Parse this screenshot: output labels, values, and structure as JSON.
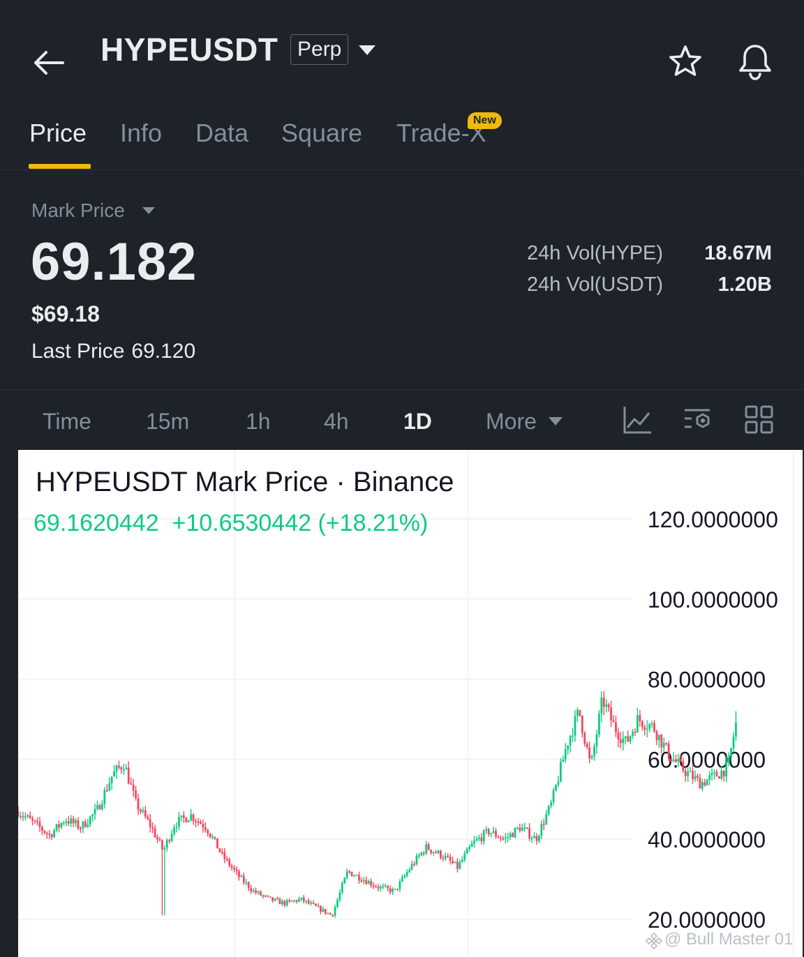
{
  "header": {
    "symbol": "HYPEUSDT",
    "contract_type": "Perp",
    "icons": [
      "back-arrow-icon",
      "caret-down-icon",
      "star-icon",
      "bell-icon"
    ]
  },
  "tabs": [
    {
      "label": "Price",
      "active": true
    },
    {
      "label": "Info"
    },
    {
      "label": "Data"
    },
    {
      "label": "Square"
    },
    {
      "label": "Trade-X",
      "badge": "New"
    }
  ],
  "price": {
    "mark_label": "Mark Price",
    "mark_price": "69.182",
    "usd_value": "$69.18",
    "last_label": "Last Price",
    "last_value": "69.120",
    "stats": [
      {
        "label": "24h Vol(HYPE)",
        "value": "18.67M"
      },
      {
        "label": "24h Vol(USDT)",
        "value": "1.20B"
      }
    ]
  },
  "intervals": [
    "Time",
    "15m",
    "1h",
    "4h",
    "1D",
    "More"
  ],
  "active_interval": "1D",
  "toolbar_icons": [
    "indicator-chart-icon",
    "settings-sliders-icon",
    "grid-layout-icon"
  ],
  "chart": {
    "title": "HYPEUSDT Mark Price · Binance",
    "last_value": "69.1620442",
    "change": "+10.6530442",
    "change_pct": "(+18.21%)",
    "y_ticks": [
      "120.0000000",
      "100.0000000",
      "80.0000000",
      "60.0000000",
      "40.0000000",
      "20.0000000"
    ]
  },
  "chart_data": {
    "type": "candlestick",
    "title": "HYPEUSDT Mark Price · Binance",
    "ylim": [
      20,
      120
    ],
    "y_ticks": [
      120,
      100,
      80,
      60,
      40,
      20
    ],
    "grid": true,
    "up_color": "#0ecb81",
    "down_color": "#f6465d",
    "close_path": [
      [
        0,
        47
      ],
      [
        0.02,
        44
      ],
      [
        0.04,
        41
      ],
      [
        0.06,
        45
      ],
      [
        0.08,
        43
      ],
      [
        0.1,
        47
      ],
      [
        0.12,
        56
      ],
      [
        0.135,
        59
      ],
      [
        0.15,
        49
      ],
      [
        0.17,
        43
      ],
      [
        0.185,
        37
      ],
      [
        0.2,
        44
      ],
      [
        0.22,
        46
      ],
      [
        0.24,
        43
      ],
      [
        0.26,
        36
      ],
      [
        0.28,
        31
      ],
      [
        0.3,
        27
      ],
      [
        0.32,
        25
      ],
      [
        0.34,
        24
      ],
      [
        0.36,
        25
      ],
      [
        0.38,
        23
      ],
      [
        0.4,
        21
      ],
      [
        0.42,
        32
      ],
      [
        0.44,
        30
      ],
      [
        0.46,
        28
      ],
      [
        0.48,
        27
      ],
      [
        0.5,
        33
      ],
      [
        0.52,
        38
      ],
      [
        0.54,
        36
      ],
      [
        0.56,
        33
      ],
      [
        0.58,
        39
      ],
      [
        0.6,
        42
      ],
      [
        0.62,
        40
      ],
      [
        0.64,
        43
      ],
      [
        0.66,
        40
      ],
      [
        0.68,
        49
      ],
      [
        0.7,
        64
      ],
      [
        0.715,
        72
      ],
      [
        0.73,
        58
      ],
      [
        0.745,
        75
      ],
      [
        0.76,
        68
      ],
      [
        0.775,
        64
      ],
      [
        0.79,
        70
      ],
      [
        0.81,
        68
      ],
      [
        0.83,
        61
      ],
      [
        0.85,
        57
      ],
      [
        0.87,
        54
      ],
      [
        0.89,
        56
      ],
      [
        0.905,
        58
      ],
      [
        0.915,
        69.16
      ]
    ],
    "wick_extremes": [
      {
        "x": 0.185,
        "low": 21
      },
      {
        "x": 0.745,
        "high": 77
      },
      {
        "x": 0.915,
        "high": 72
      }
    ],
    "last": 69.1620442,
    "change": 10.6530442,
    "change_pct": 18.21
  },
  "watermark": "@ Bull Master 01",
  "colors": {
    "background": "#1e2329",
    "accent": "#f0b90b",
    "up": "#0ecb81",
    "down": "#f6465d",
    "muted": "#848e9c"
  }
}
